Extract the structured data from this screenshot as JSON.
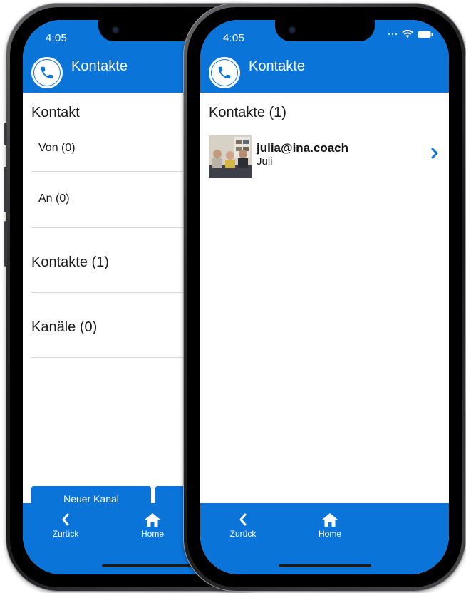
{
  "back_phone": {
    "status_time": "4:05",
    "header_title": "Kontakte",
    "sections": {
      "kontakt": "Kontakt",
      "von": "Von (0)",
      "an": "An (0)",
      "kontakte": "Kontakte (1)",
      "kanaele": "Kanäle (0)"
    },
    "buttons": {
      "neuer_kanal": "Neuer Kanal"
    },
    "tabbar": {
      "back_label": "Zurück",
      "home_label": "Home"
    }
  },
  "front_phone": {
    "status_time": "4:05",
    "header_title": "Kontakte",
    "section_title": "Kontakte (1)",
    "contacts": [
      {
        "name": "julia@ina.coach",
        "subtitle": "Juli"
      }
    ],
    "tabbar": {
      "back_label": "Zurück",
      "home_label": "Home"
    }
  },
  "colors": {
    "brand": "#0a74d8",
    "text": "#1a1a1a",
    "divider": "#d6d6d6"
  },
  "icons": [
    "phone-icon",
    "wifi-icon",
    "battery-icon",
    "chevron-left-icon",
    "home-icon",
    "chevron-right-icon"
  ]
}
